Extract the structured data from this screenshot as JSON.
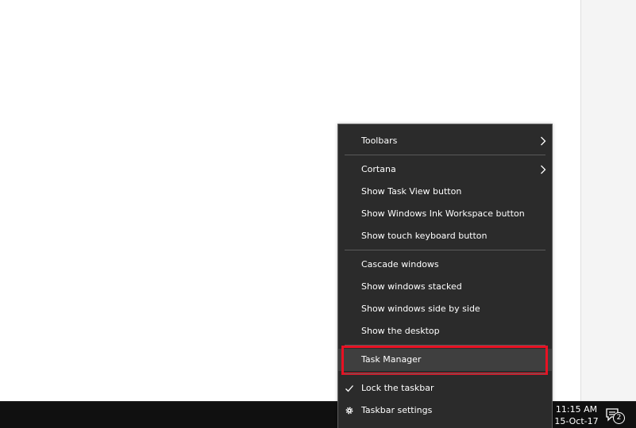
{
  "context_menu": {
    "items": [
      {
        "label": "Toolbars",
        "icon": "chevron-right-icon"
      },
      {
        "label": "Cortana",
        "icon": "chevron-right-icon"
      },
      {
        "label": "Show Task View button"
      },
      {
        "label": "Show Windows Ink Workspace button"
      },
      {
        "label": "Show touch keyboard button"
      },
      {
        "label": "Cascade windows"
      },
      {
        "label": "Show windows stacked"
      },
      {
        "label": "Show windows side by side"
      },
      {
        "label": "Show the desktop"
      },
      {
        "label": "Task Manager",
        "highlighted": true,
        "highlight_color": "#e81123"
      },
      {
        "label": "Lock the taskbar",
        "checked": true,
        "icon": "checkmark-icon"
      },
      {
        "label": "Taskbar settings",
        "icon": "gear-icon"
      }
    ]
  },
  "taskbar": {
    "clock": {
      "time": "11:15 AM",
      "date": "15-Oct-17"
    },
    "notifications": {
      "count": "2",
      "icon": "action-center-icon"
    }
  },
  "colors": {
    "menu_background": "#2b2b2b",
    "taskbar_background": "#101010",
    "highlight_border": "#e81123"
  }
}
